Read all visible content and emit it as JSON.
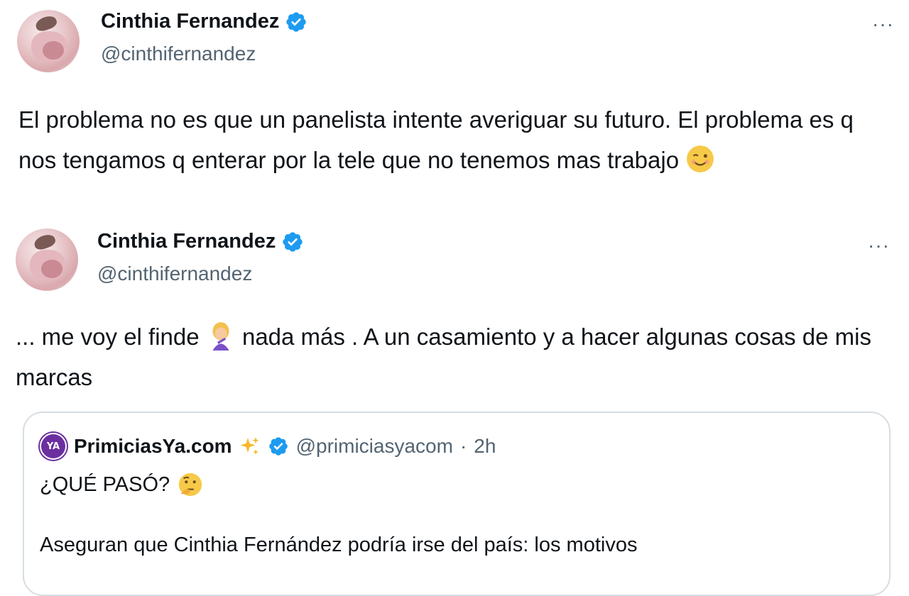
{
  "tweets": [
    {
      "author": {
        "name": "Cinthia Fernandez",
        "handle": "@cinthifernandez",
        "verified": true,
        "avatar_icon": "profile-photo"
      },
      "more_label": "···",
      "text_parts": [
        "El problema no es que un panelista intente averiguar su futuro. El problema es q nos tengamos q enterar por la tele que no tenemos mas trabajo"
      ],
      "emoji": "winking-face-emoji"
    },
    {
      "author": {
        "name": "Cinthia Fernandez",
        "handle": "@cinthifernandez",
        "verified": true,
        "avatar_icon": "profile-photo"
      },
      "more_label": "···",
      "text_part1": "... me voy el finde",
      "emoji": "woman-facepalming-emoji",
      "text_part2": "nada más . A un casamiento y a hacer algunas cosas de mis marcas",
      "quote": {
        "name": "PrimiciasYa.com",
        "name_emoji": "sparkles-emoji",
        "verified": true,
        "handle": "@primiciasyacom",
        "separator": "·",
        "time": "2h",
        "avatar_label": "YA",
        "line1": "¿QUÉ PASÓ?",
        "line1_emoji": "thinking-face-emoji",
        "line2": "Aseguran que Cinthia Fernández podría irse del país: los motivos"
      }
    }
  ],
  "colors": {
    "text": "#0f1419",
    "secondary": "#536471",
    "verified_blue": "#1d9bf0",
    "border": "#d7dde2",
    "brand_purple": "#6b2fa0"
  }
}
